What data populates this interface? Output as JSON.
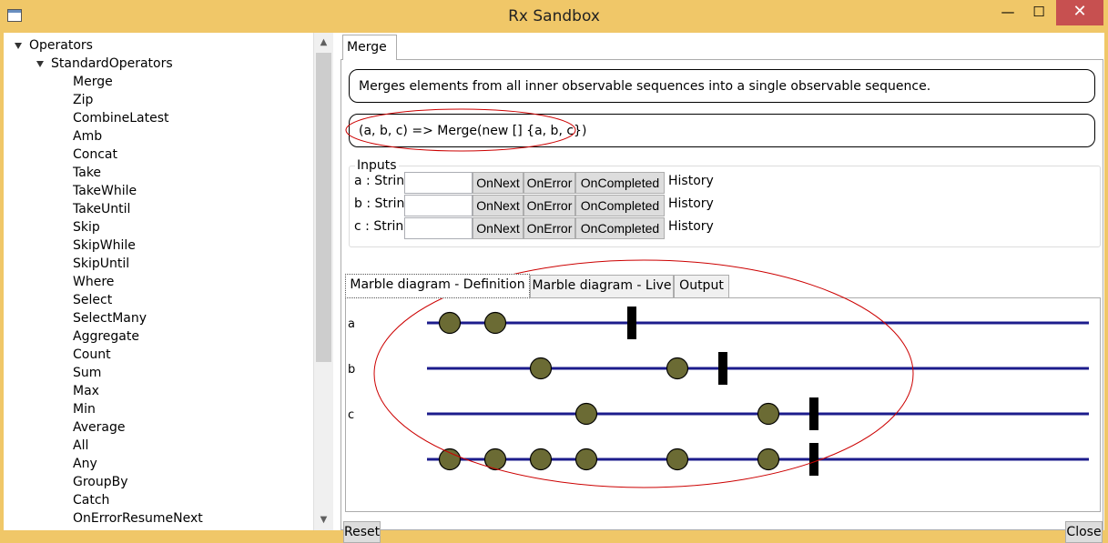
{
  "window": {
    "title": "Rx Sandbox",
    "minimize": "—",
    "maximize": "☐",
    "close": "✕"
  },
  "tree": {
    "root": "Operators",
    "group": "StandardOperators",
    "items": [
      "Merge",
      "Zip",
      "CombineLatest",
      "Amb",
      "Concat",
      "Take",
      "TakeWhile",
      "TakeUntil",
      "Skip",
      "SkipWhile",
      "SkipUntil",
      "Where",
      "Select",
      "SelectMany",
      "Aggregate",
      "Count",
      "Sum",
      "Max",
      "Min",
      "Average",
      "All",
      "Any",
      "GroupBy",
      "Catch",
      "OnErrorResumeNext"
    ],
    "selected": "Merge"
  },
  "main": {
    "tab": "Merge",
    "description": "Merges elements from all inner observable sequences into a single observable sequence.",
    "expression": "(a, b, c) => Merge(new [] {a, b, c})",
    "inputs": {
      "legend": "Inputs",
      "rows": [
        {
          "label": "a : String",
          "value": ""
        },
        {
          "label": "b : String",
          "value": ""
        },
        {
          "label": "c : String",
          "value": ""
        }
      ],
      "buttons": {
        "on_next": "OnNext",
        "on_error": "OnError",
        "on_completed": "OnCompleted",
        "history": "History"
      }
    },
    "subtabs": [
      "Marble diagram - Definition",
      "Marble diagram - Live",
      "Output"
    ],
    "active_subtab": "Marble diagram - Definition",
    "reset": "Reset",
    "close": "Close"
  },
  "marble": {
    "line_color": "#1c1c8c",
    "marble_color": "#6b6b34",
    "rows": [
      {
        "label": "a",
        "events": [
          1,
          2
        ],
        "completed": 5
      },
      {
        "label": "b",
        "events": [
          3,
          6
        ],
        "completed": 7
      },
      {
        "label": "c",
        "events": [
          4,
          8
        ],
        "completed": 9
      },
      {
        "label": "",
        "events": [
          1,
          2,
          3,
          4,
          6,
          8
        ],
        "completed": 9
      }
    ]
  },
  "annotation_color": "#cc0000"
}
